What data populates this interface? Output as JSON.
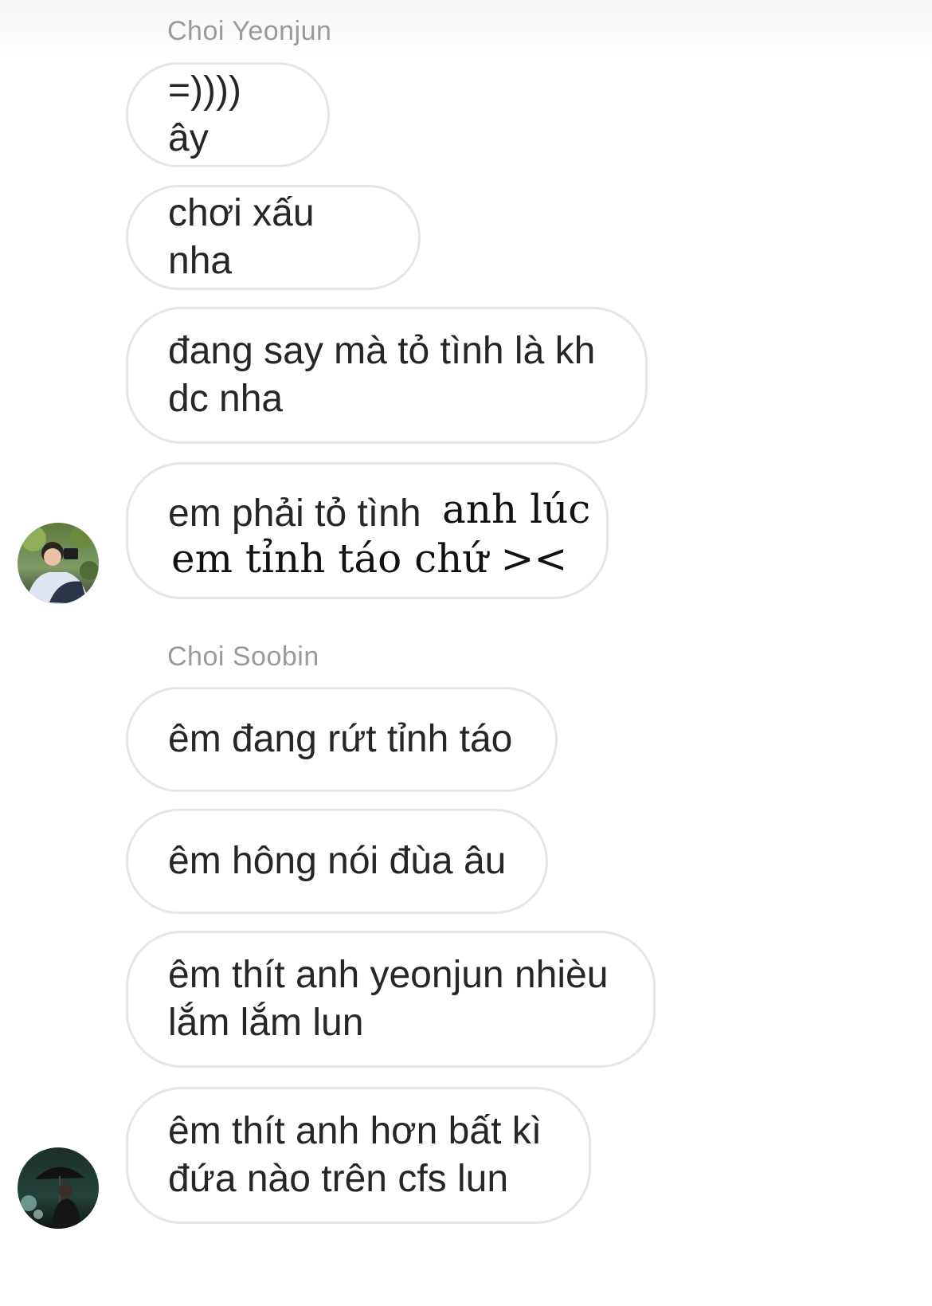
{
  "thread": [
    {
      "sender": "Choi Yeonjun",
      "messages": [
        "=)))) ây",
        "chơi xấu nha",
        "đang say mà tỏ tình là kh dc nha",
        {
          "part1": "em phải tỏ tình",
          "part2": "anh lúc",
          "part3": "em tỉnh táo chứ ><"
        }
      ],
      "avatar_icon": "profile-photo-person-with-camera"
    },
    {
      "sender": "Choi Soobin",
      "messages": [
        "êm đang rứt tỉnh táo",
        "êm hông nói đùa âu",
        "êm thít anh yeonjun nhièu lắm lắm lun",
        "êm thít anh hơn bất kì đứa nào trên cfs lun"
      ],
      "avatar_icon": "profile-photo-person-with-umbrella"
    }
  ],
  "colors": {
    "bubble_border": "#e6e6e6",
    "text": "#262626",
    "sender_name": "#9a9a9a"
  }
}
